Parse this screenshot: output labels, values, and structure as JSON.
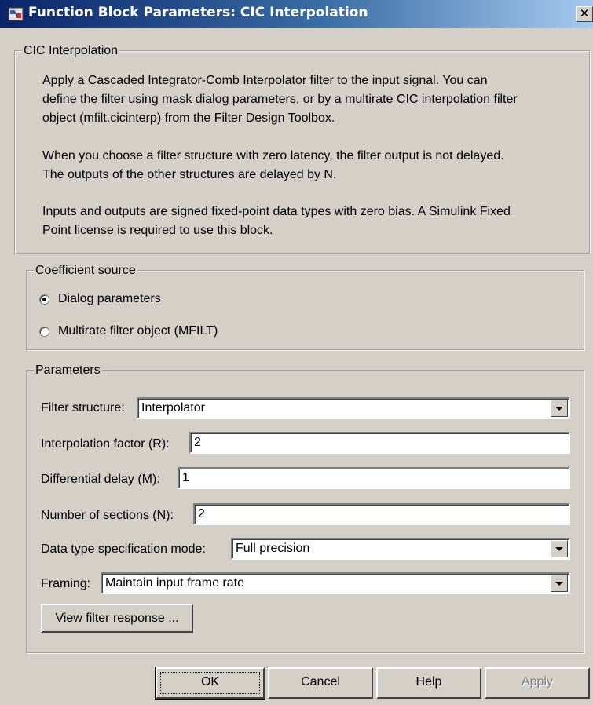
{
  "window": {
    "title": "Function Block Parameters: CIC Interpolation",
    "close_glyph": "✕",
    "icon": "simulink-block-icon"
  },
  "description": {
    "legend": "CIC Interpolation",
    "para1_lines": [
      "Apply a Cascaded Integrator-Comb Interpolator filter to the input signal. You can",
      "define the filter using mask dialog parameters, or by a multirate CIC interpolation filter",
      "object (mfilt.cicinterp) from the Filter Design Toolbox."
    ],
    "para2_lines": [
      "When you choose a filter structure with zero latency, the filter output is not delayed.",
      "The outputs of the other structures are delayed by N."
    ],
    "para3_lines": [
      "Inputs and outputs are signed fixed-point data types with zero bias.  A Simulink Fixed",
      "Point license is required to use this block."
    ]
  },
  "coefficient_source": {
    "legend": "Coefficient source",
    "options": [
      {
        "label": "Dialog parameters",
        "selected": true
      },
      {
        "label": "Multirate filter object (MFILT)",
        "selected": false
      }
    ]
  },
  "parameters": {
    "legend": "Parameters",
    "filter_structure": {
      "label": "Filter structure:",
      "value": "Interpolator"
    },
    "interpolation_factor": {
      "label": "Interpolation factor (R):",
      "value": "2"
    },
    "differential_delay": {
      "label": "Differential delay (M):",
      "value": "1"
    },
    "number_of_sections": {
      "label": "Number of sections (N):",
      "value": "2"
    },
    "data_type_mode": {
      "label": "Data type specification mode:",
      "value": "Full precision"
    },
    "framing": {
      "label": "Framing:",
      "value": "Maintain input frame rate"
    },
    "view_filter_response_label": "View filter response ..."
  },
  "buttons": {
    "ok": "OK",
    "cancel": "Cancel",
    "help": "Help",
    "apply": "Apply"
  },
  "colors": {
    "dialog_bg": "#d4d0c8",
    "titlebar_start": "#0a246a",
    "titlebar_end": "#a6caf0"
  }
}
